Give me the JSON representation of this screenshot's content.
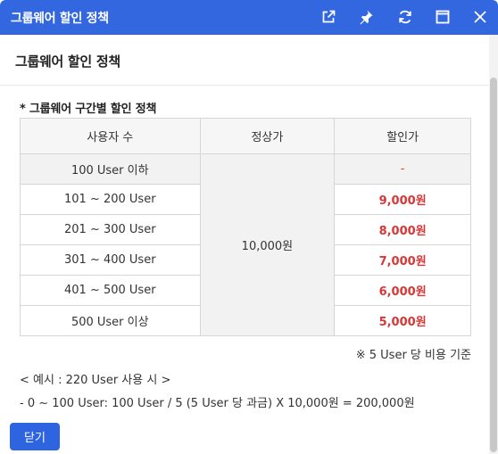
{
  "window": {
    "title": "그룹웨어 할인 정책",
    "icons": [
      "external-link-icon",
      "pin-icon",
      "refresh-icon",
      "maximize-icon",
      "close-icon"
    ]
  },
  "page": {
    "title": "그룹웨어 할인 정책",
    "section_title": "* 그룹웨어 구간별 할인 정책"
  },
  "table": {
    "headers": [
      "사용자 수",
      "정상가",
      "할인가"
    ],
    "regular_price": "10,000원",
    "rows": [
      {
        "users": "100 User 이하",
        "discount": "-"
      },
      {
        "users": "101 ~ 200 User",
        "discount": "9,000원"
      },
      {
        "users": "201 ~ 300 User",
        "discount": "8,000원"
      },
      {
        "users": "301 ~ 400 User",
        "discount": "7,000원"
      },
      {
        "users": "401 ~ 500 User",
        "discount": "6,000원"
      },
      {
        "users": "500 User 이상",
        "discount": "5,000원"
      }
    ]
  },
  "note": "※ 5 User 당 비용 기준",
  "example": {
    "title": "< 예시 : 220 User 사용 시 >",
    "line": "- 0 ~ 100 User: 100 User / 5 (5 User 당 과금) X 10,000원 = 200,000원"
  },
  "buttons": {
    "close": "닫기"
  },
  "colors": {
    "titlebar": "#3367e0",
    "button": "#2f64e0",
    "discount_text": "#d93636"
  }
}
